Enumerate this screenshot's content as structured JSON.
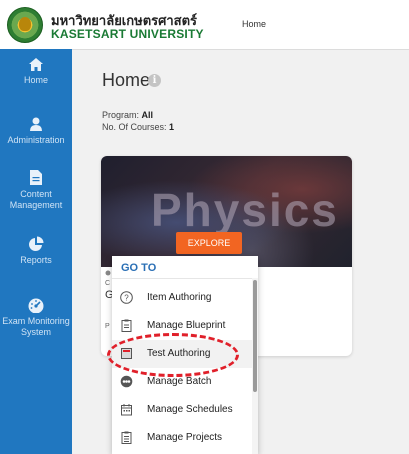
{
  "header": {
    "university_thai": "มหาวิทยาลัยเกษตรศาสตร์",
    "university_en": "KASETSART UNIVERSITY",
    "breadcrumb": "Home"
  },
  "sidebar": {
    "items": [
      {
        "label": "Home",
        "icon": "home-icon"
      },
      {
        "label": "Administration",
        "icon": "user-icon"
      },
      {
        "label": "Content Management",
        "icon": "document-icon"
      },
      {
        "label": "Reports",
        "icon": "pie-chart-icon"
      },
      {
        "label": "Exam Monitoring System",
        "icon": "gauge-icon"
      }
    ]
  },
  "main": {
    "title": "Home",
    "info_icon": "i",
    "program_label": "Program:",
    "program_value": "All",
    "courses_label": "No. Of Courses:",
    "courses_value": "1"
  },
  "card": {
    "hero_text": "Physics",
    "explore_label": "EXPLORE",
    "frag_c": "C",
    "frag_g": "G",
    "frag_p": "P"
  },
  "goto_menu": {
    "title": "GO TO",
    "items": [
      {
        "label": "Item Authoring",
        "icon": "question-circle-icon"
      },
      {
        "label": "Manage Blueprint",
        "icon": "clipboard-icon"
      },
      {
        "label": "Test Authoring",
        "icon": "test-sheet-icon"
      },
      {
        "label": "Manage Batch",
        "icon": "batch-icon"
      },
      {
        "label": "Manage Schedules",
        "icon": "calendar-icon"
      },
      {
        "label": "Manage Projects",
        "icon": "clipboard-list-icon"
      }
    ]
  },
  "colors": {
    "sidebar": "#2077c0",
    "explore": "#f26522",
    "goto_title": "#2a6fb5",
    "annotation": "#e0202a",
    "brand_green": "#1a7a34"
  }
}
